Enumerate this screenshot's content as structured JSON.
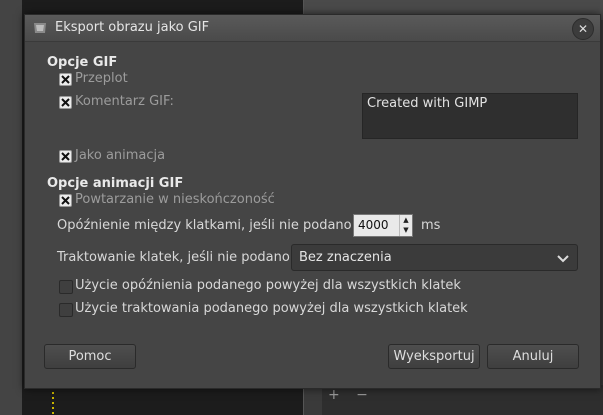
{
  "dialog": {
    "title": "Eksport obrazu jako GIF",
    "close_label": "✕"
  },
  "gif_options": {
    "heading": "Opcje GIF",
    "interlace": {
      "label": "Przeplot",
      "checked": true
    },
    "comment": {
      "label": "Komentarz GIF:",
      "checked": true,
      "value": "Created with GIMP"
    },
    "as_animation": {
      "label": "Jako animacja",
      "checked": true
    }
  },
  "animation_options": {
    "heading": "Opcje animacji GIF",
    "loop_forever": {
      "label": "Powtarzanie w nieskończoność",
      "checked": true
    },
    "delay_label": "Opóźnienie między klatkami, jeśli nie podano:",
    "delay_value": "4000",
    "delay_unit": "ms",
    "disposal_label": "Traktowanie klatek, jeśli nie podano:",
    "disposal_value": "Bez znaczenia",
    "use_delay_all": {
      "label": "Użycie opóźnienia podanego powyżej dla wszystkich klatek",
      "checked": false
    },
    "use_disposal_all": {
      "label": "Użycie traktowania podanego powyżej dla wszystkich klatek",
      "checked": false
    }
  },
  "buttons": {
    "help": "Pomoc",
    "export": "Wyeksportuj",
    "cancel": "Anuluj"
  },
  "background": {
    "panel_buttons": "+ −"
  }
}
